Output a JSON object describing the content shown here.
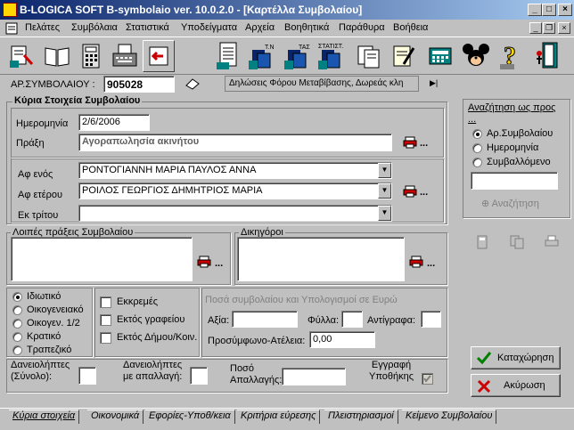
{
  "window": {
    "title": "B-LOGICA SOFT  B-symbolaio ver. 10.0.2.0 - [Καρτέλλα Συμβολαίου]"
  },
  "menu": {
    "items": [
      "Πελάτες",
      "Συμβόλαια",
      "Στατιστικά",
      "Υποδείγματα",
      "Αρχεία",
      "Βοηθητικά",
      "Παράθυρα",
      "Βοήθεια"
    ]
  },
  "toolbar": {
    "tn_label": "T.N",
    "tas_label": "ΤΑΣ",
    "statist_label": "ΣΤΑΤΙΣΤ."
  },
  "header": {
    "contract_no_label": "ΑΡ.ΣΥΜΒΟΛΑΙΟΥ :",
    "contract_no": "905028",
    "info": "Δηλώσεις Φόρου Μεταβίβασης, Δωρεάς κλη"
  },
  "main": {
    "group_title": "Κύρια Στοιχεία Συμβολαίου",
    "date_label": "Ημερομηνία",
    "date": "2/6/2006",
    "action_label": "Πράξη",
    "action": "Αγοραπωλησία ακινήτου",
    "party1_label": "Αφ ενός",
    "party1": "ΡΟΝΤΟΓΙΑΝΝΗ ΜΑΡΙΑ ΠΑΥΛΟΣ ΑΝΝΑ",
    "party2_label": "Αφ ετέρου",
    "party2": "ΡΟΙΛΟΣ ΓΕΩΡΓΙΟΣ ΔΗΜΗΤΡΙΟΣ ΜΑΡΙΑ",
    "party3_label": "Εκ τρίτου",
    "party3": "",
    "other_actions_label": "Λοιπές πράξεις Συμβολαίου",
    "lawyers_label": "Δικηγόροι"
  },
  "type_radios": [
    "Ιδιωτικό",
    "Οικογενειακό",
    "Οικογεν. 1/2",
    "Κρατικό",
    "Τραπεζικό"
  ],
  "checks": [
    "Εκκρεμές",
    "Εκτός γραφείου",
    "Εκτός Δήμου/Κοιν."
  ],
  "amounts": {
    "title": "Ποσά συμβολαίου και Υπολογισμοί σε Ευρώ",
    "value_label": "Αξία:",
    "sheets_label": "Φύλλα:",
    "copies_label": "Αντίγραφα:",
    "stamp_label": "Προσύμφωνο-Ατέλεια:",
    "stamp_value": "0,00"
  },
  "bottom": {
    "borrowers_label": "Δανειολήπτες\n(Σύνολο):",
    "borrowers_exempt_label": "Δανειολήπτες\nμε απαλλαγή:",
    "exempt_amount_label": "Ποσό\nΑπαλλαγής:",
    "mortgage_label": "Εγγραφή\nΥποθήκης"
  },
  "search": {
    "title": "Αναζήτηση ως προς ...",
    "options": [
      "Αρ.Συμβολαίου",
      "Ημερομηνία",
      "Συμβαλλόμενο"
    ],
    "button": "Αναζήτηση"
  },
  "actions": {
    "save": "Καταχώρηση",
    "cancel": "Ακύρωση"
  },
  "tabs": [
    "Κύρια στοιχεία",
    "Οικονομικά",
    "Εφορίες-Υποθ/κεια",
    "Κριτήρια εύρεσης",
    "Πλειστηριασμοί",
    "Κείμενο Συμβολαίου"
  ],
  "colors": {
    "titlebar": "#0a246a",
    "highlight_field": "#fff"
  }
}
